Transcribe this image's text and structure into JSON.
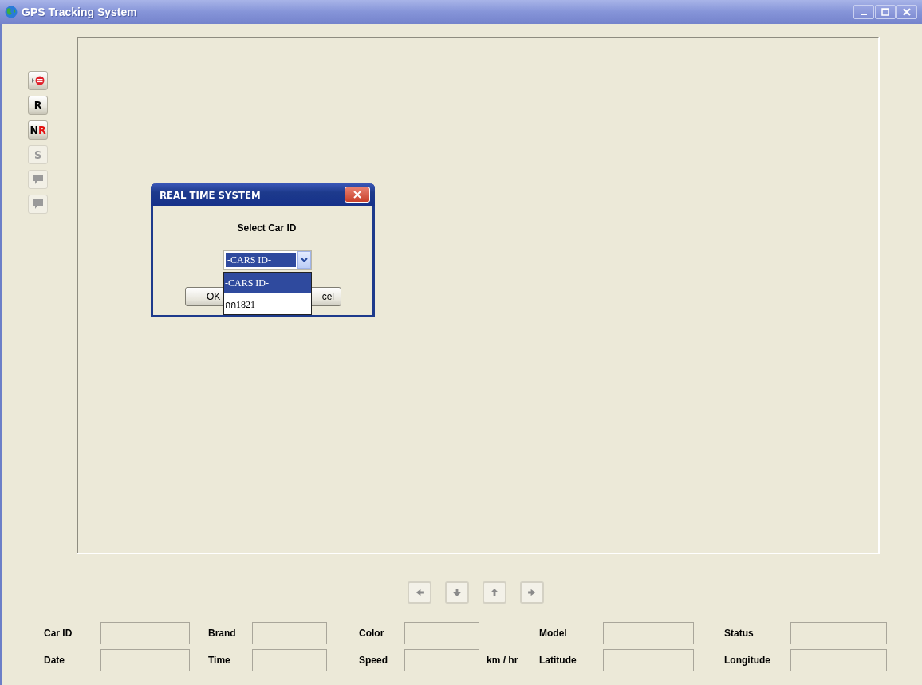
{
  "window": {
    "title": "GPS Tracking System"
  },
  "toolbar": [
    {
      "kind": "icon",
      "disabled": false
    },
    {
      "kind": "text",
      "label": "R",
      "last_letter_red": false,
      "disabled": false
    },
    {
      "kind": "text",
      "label": "NR",
      "last_letter_red": true,
      "disabled": false
    },
    {
      "kind": "text",
      "label": "S",
      "last_letter_red": false,
      "disabled": true
    },
    {
      "kind": "chat",
      "disabled": true
    },
    {
      "kind": "chat",
      "disabled": true
    }
  ],
  "dialog": {
    "title": "REAL TIME SYSTEM",
    "prompt": "Select Car ID",
    "select": {
      "value": "-CARS ID-",
      "expanded": true,
      "options": [
        {
          "label": "-CARS ID-",
          "selected": true
        },
        {
          "label": "กก1821",
          "selected": false
        }
      ]
    },
    "buttons": [
      {
        "label": "OK"
      },
      {
        "label": "cel"
      }
    ]
  },
  "nav": [
    {
      "kind": "left"
    },
    {
      "kind": "down"
    },
    {
      "kind": "up"
    },
    {
      "kind": "right"
    }
  ],
  "form": [
    [
      {
        "label": "Car ID"
      },
      {
        "label": "Brand"
      },
      {
        "label": "Color"
      },
      {
        "label": "Model"
      },
      {
        "label": "Status"
      }
    ],
    [
      {
        "label": "Date"
      },
      {
        "label": "Time"
      },
      {
        "label": "Speed",
        "unit": "km / hr"
      },
      {
        "label": "Latitude"
      },
      {
        "label": "Longitude"
      }
    ]
  ]
}
